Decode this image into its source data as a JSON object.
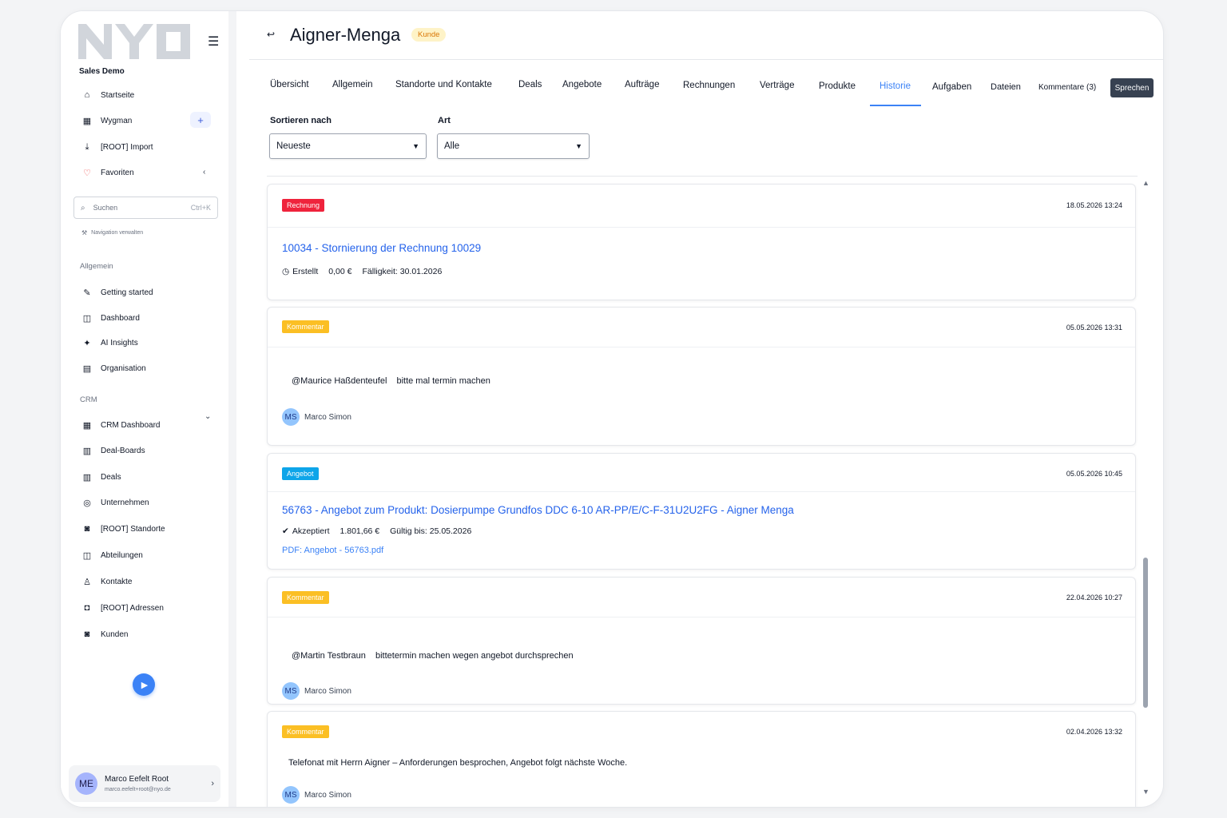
{
  "sidebar": {
    "workspace": "Sales Demo",
    "top_items": [
      {
        "label": "Startseite",
        "icon": "home-icon"
      },
      {
        "label": "Wygman",
        "icon": "layout-icon"
      },
      {
        "label": "[ROOT] Import",
        "icon": "download-icon"
      },
      {
        "label": "Favoriten",
        "icon": "heart-icon"
      }
    ],
    "search_placeholder": "Suchen",
    "search_shortcut": "Ctrl+K",
    "manage_navigation": "Navigation verwalten",
    "section_general": "Allgemein",
    "general_items": [
      {
        "label": "Getting started",
        "icon": "rocket-icon"
      },
      {
        "label": "Dashboard",
        "icon": "chart-icon"
      },
      {
        "label": "AI Insights",
        "icon": "sparkle-icon"
      },
      {
        "label": "Organisation",
        "icon": "building-icon"
      }
    ],
    "section_crm": "CRM",
    "crm_items": [
      {
        "label": "CRM Dashboard",
        "icon": "grid-icon"
      },
      {
        "label": "Deal-Boards",
        "icon": "board-icon"
      },
      {
        "label": "Deals",
        "icon": "columns-icon"
      },
      {
        "label": "Unternehmen",
        "icon": "company-icon"
      },
      {
        "label": "[ROOT] Standorte",
        "icon": "location-icon"
      },
      {
        "label": "Abteilungen",
        "icon": "department-icon"
      },
      {
        "label": "Kontakte",
        "icon": "contacts-icon"
      },
      {
        "label": "[ROOT] Adressen",
        "icon": "address-icon"
      },
      {
        "label": "Kunden",
        "icon": "customer-icon"
      }
    ],
    "user": {
      "initials": "ME",
      "name": "Marco Eefelt Root",
      "email": "marco.eefelt+root@nyo.de"
    }
  },
  "header": {
    "title": "Aigner-Menga",
    "badge": "Kunde"
  },
  "tabs": [
    {
      "label": "Übersicht"
    },
    {
      "label": "Allgemein"
    },
    {
      "label": "Standorte und Kontakte"
    },
    {
      "label": "Deals"
    },
    {
      "label": "Angebote"
    },
    {
      "label": "Aufträge"
    },
    {
      "label": "Rechnungen"
    },
    {
      "label": "Verträge"
    },
    {
      "label": "Produkte"
    },
    {
      "label": "Historie"
    },
    {
      "label": "Aufgaben"
    },
    {
      "label": "Dateien"
    },
    {
      "label": "Kommentare (3)"
    }
  ],
  "active_tab": "Historie",
  "speak_button": "Sprechen",
  "filters": {
    "sort_label": "Sortieren nach",
    "sort_value": "Neueste",
    "type_label": "Art",
    "type_value": "Alle"
  },
  "timeline": [
    {
      "type": "Rechnung",
      "date": "18.05.2026 13:24",
      "title": "10034 - Stornierung der Rechnung 10029",
      "status": "Erstellt",
      "amount": "0,00 €",
      "due": "Fälligkeit: 30.01.2026"
    },
    {
      "type": "Kommentar",
      "date": "05.05.2026 13:31",
      "mention": "@Maurice Haßdenteufel",
      "text": "bitte mal termin machen",
      "author_initials": "MS",
      "author": "Marco Simon"
    },
    {
      "type": "Angebot",
      "date": "05.05.2026 10:45",
      "title": "56763 - Angebot zum Produkt: Dosierpumpe Grundfos DDC 6-10 AR-PP/E/C-F-31U2U2FG - Aigner Menga",
      "status": "Akzeptiert",
      "amount": "1.801,66 €",
      "valid": "Gültig bis: 25.05.2026",
      "pdf": "PDF: Angebot - 56763.pdf"
    },
    {
      "type": "Kommentar",
      "date": "22.04.2026 10:27",
      "mention": "@Martin Testbraun",
      "text": "bittetermin machen wegen angebot durchsprechen",
      "author_initials": "MS",
      "author": "Marco Simon"
    },
    {
      "type": "Kommentar",
      "date": "02.04.2026 13:32",
      "text": "Telefonat mit Herrn Aigner – Anforderungen besprochen, Angebot folgt nächste Woche.",
      "author_initials": "MS",
      "author": "Marco Simon"
    }
  ],
  "colors": {
    "accent": "#3b82f6",
    "rechnung": "#ef233c",
    "kommentar": "#fbbf24",
    "angebot": "#0ea5e9",
    "kunde_badge": "#fef3c7"
  }
}
